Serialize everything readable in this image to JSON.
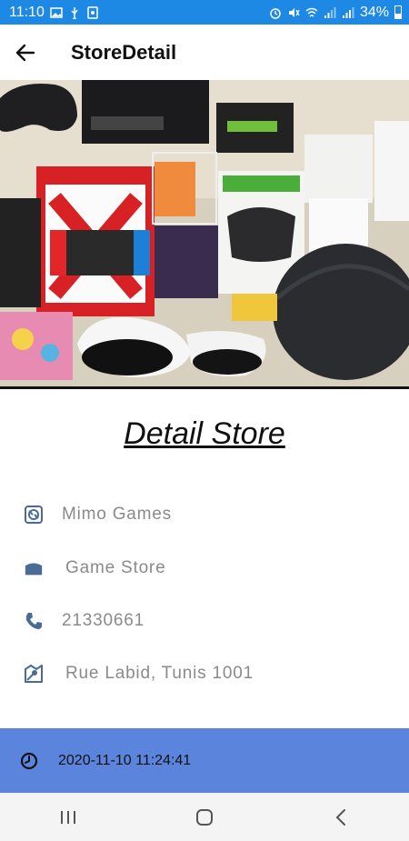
{
  "status_bar": {
    "time": "11:10",
    "battery": "34%"
  },
  "app_bar": {
    "title": "StoreDetail"
  },
  "hero": {
    "image": "store-products-photo"
  },
  "detail": {
    "heading": "Detail Store",
    "items": [
      {
        "icon": "store-logo-icon",
        "text": "Mimo Games"
      },
      {
        "icon": "store-type-icon",
        "text": "Game Store"
      },
      {
        "icon": "phone-icon",
        "text": "21330661"
      },
      {
        "icon": "map-icon",
        "text": "Rue Labid, Tunis 1001"
      }
    ]
  },
  "footer": {
    "date": "2020-11-10 11:24:41"
  },
  "colors": {
    "status_bar": "#1e88e5",
    "date_bar": "#5b84dc",
    "icon": "#4a6b94",
    "muted_text": "#8a8a8a"
  }
}
